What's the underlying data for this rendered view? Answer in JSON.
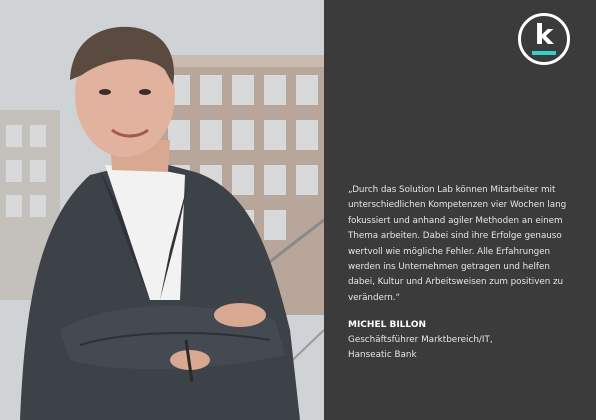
{
  "quote": {
    "lines": [
      "„Durch das Solution Lab können Mitarbeiter mit",
      "unterschiedlichen Kompetenzen vier Wochen lang",
      "fokussiert und anhand agiler Methoden an einem",
      "Thema arbeiten. Dabei  sind ihre Erfolge genauso",
      "wertvoll wie mögliche Fehler. Alle Erfahrungen",
      "werden ins Unternehmen getragen und helfen",
      "dabei, Kultur und Arbeitsweisen zum positiven zu",
      "verändern.“"
    ]
  },
  "author": {
    "name": "MICHEL BILLON",
    "role_lines": [
      "Geschäftsführer Marktbereich/IT,",
      "Hanseatic Bank"
    ]
  },
  "logo": {
    "letter": "k",
    "accent": "#35d1c4"
  },
  "colors": {
    "panel": "#3b3b3b",
    "text": "#e6e6e6"
  }
}
